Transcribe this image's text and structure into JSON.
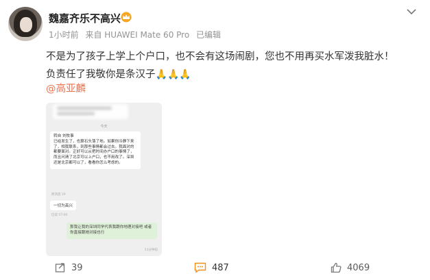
{
  "post": {
    "author": "魏嘉齐乐不高兴",
    "time": "1小时前",
    "source": "来自 HUAWEI Mate 60 Pro",
    "edited": "已编辑",
    "text_line1": "不是为了孩子上学上个户口，也不会有这场闹剧，您也不用再买水军泼我脏水！",
    "text_line2": "负责任了我敬你是条汉子",
    "emoji": "🙏",
    "mention": "@高亚麟"
  },
  "chat_image": {
    "time": "今天",
    "message_name": "转自 刘牧事",
    "message_body": "已经发生了，也算石头落了地。如果你冷静下来了，相我联系，到那些事情都会过去。我面对的都要面对。正好可以从把时间办户口的事情了，而且问清了北京可以上户口，也不用改了。深圳还是北京都可以了，看看你怎么考虑的。",
    "message_meta": "原消息 59",
    "short_message": "一切为高兴",
    "short_meta": "已读 57:00",
    "reply": "那我让我的深圳同学代表我跟你地理对接吧 或者你直接跟她对接也行",
    "read_status": "53分钟前"
  },
  "actions": {
    "repost_count": "39",
    "comment_count": "487",
    "like_count": "4069"
  },
  "colors": {
    "mention": "#eb7350",
    "comment_icon": "#f08f1a",
    "crown": "#f5a623"
  }
}
